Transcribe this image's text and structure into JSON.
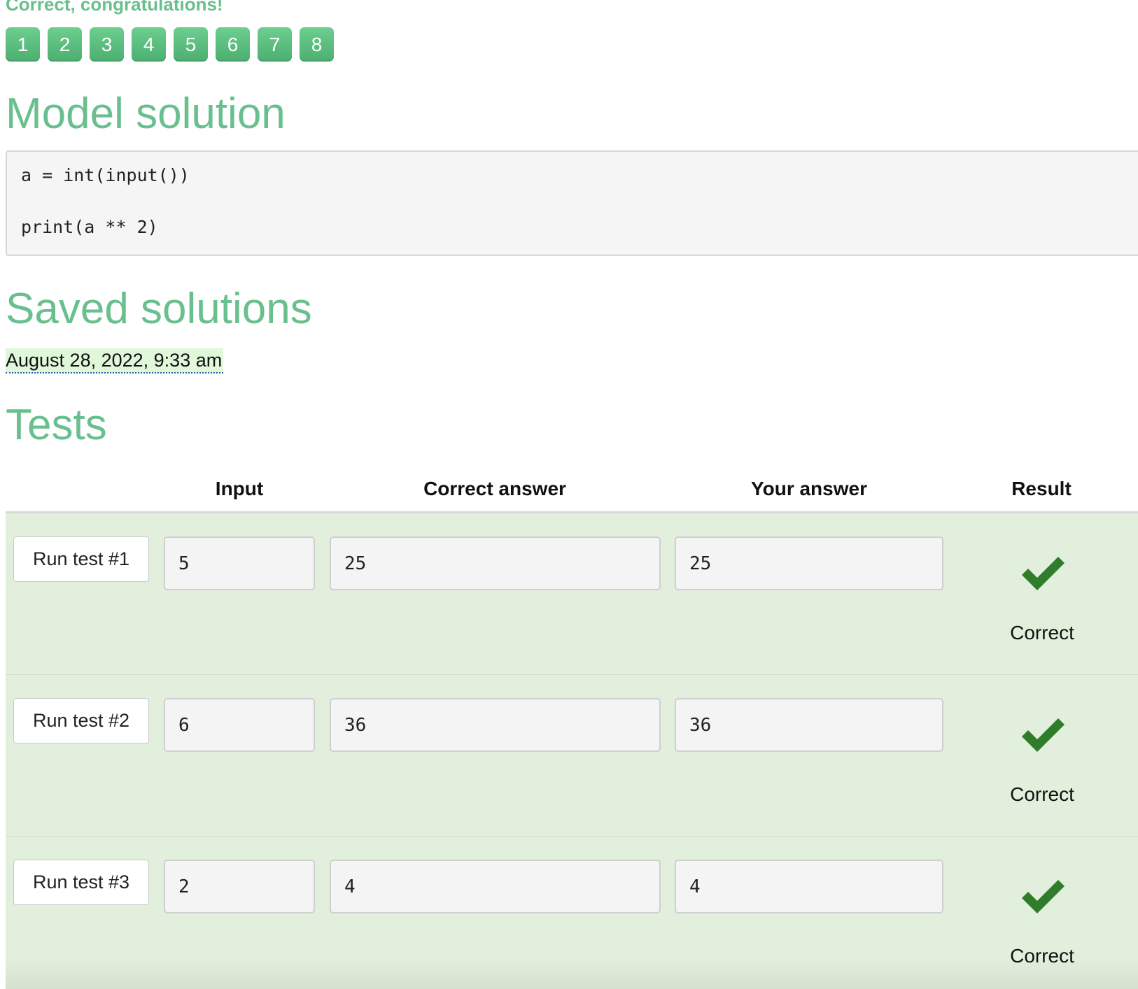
{
  "status_message": "Correct, congratulations!",
  "steps": [
    "1",
    "2",
    "3",
    "4",
    "5",
    "6",
    "7",
    "8"
  ],
  "model_solution": {
    "title": "Model solution",
    "code_lines": [
      "a = int(input())",
      "print(a ** 2)"
    ]
  },
  "saved_solutions": {
    "title": "Saved solutions",
    "entries": [
      "August 28, 2022, 9:33 am"
    ]
  },
  "tests": {
    "title": "Tests",
    "columns": {
      "input": "Input",
      "correct_answer": "Correct answer",
      "your_answer": "Your answer",
      "result": "Result"
    },
    "rows": [
      {
        "button": "Run test #1",
        "input": "5",
        "correct": "25",
        "yours": "25",
        "result": "Correct",
        "result_icon": "checkmark-icon"
      },
      {
        "button": "Run test #2",
        "input": "6",
        "correct": "36",
        "yours": "36",
        "result": "Correct",
        "result_icon": "checkmark-icon"
      },
      {
        "button": "Run test #3",
        "input": "2",
        "correct": "4",
        "yours": "4",
        "result": "Correct",
        "result_icon": "checkmark-icon"
      }
    ]
  },
  "colors": {
    "accent_green": "#6abf8e",
    "step_button": "#5cbf80",
    "row_background": "#e2efdc",
    "checkmark": "#2f7d2a"
  }
}
